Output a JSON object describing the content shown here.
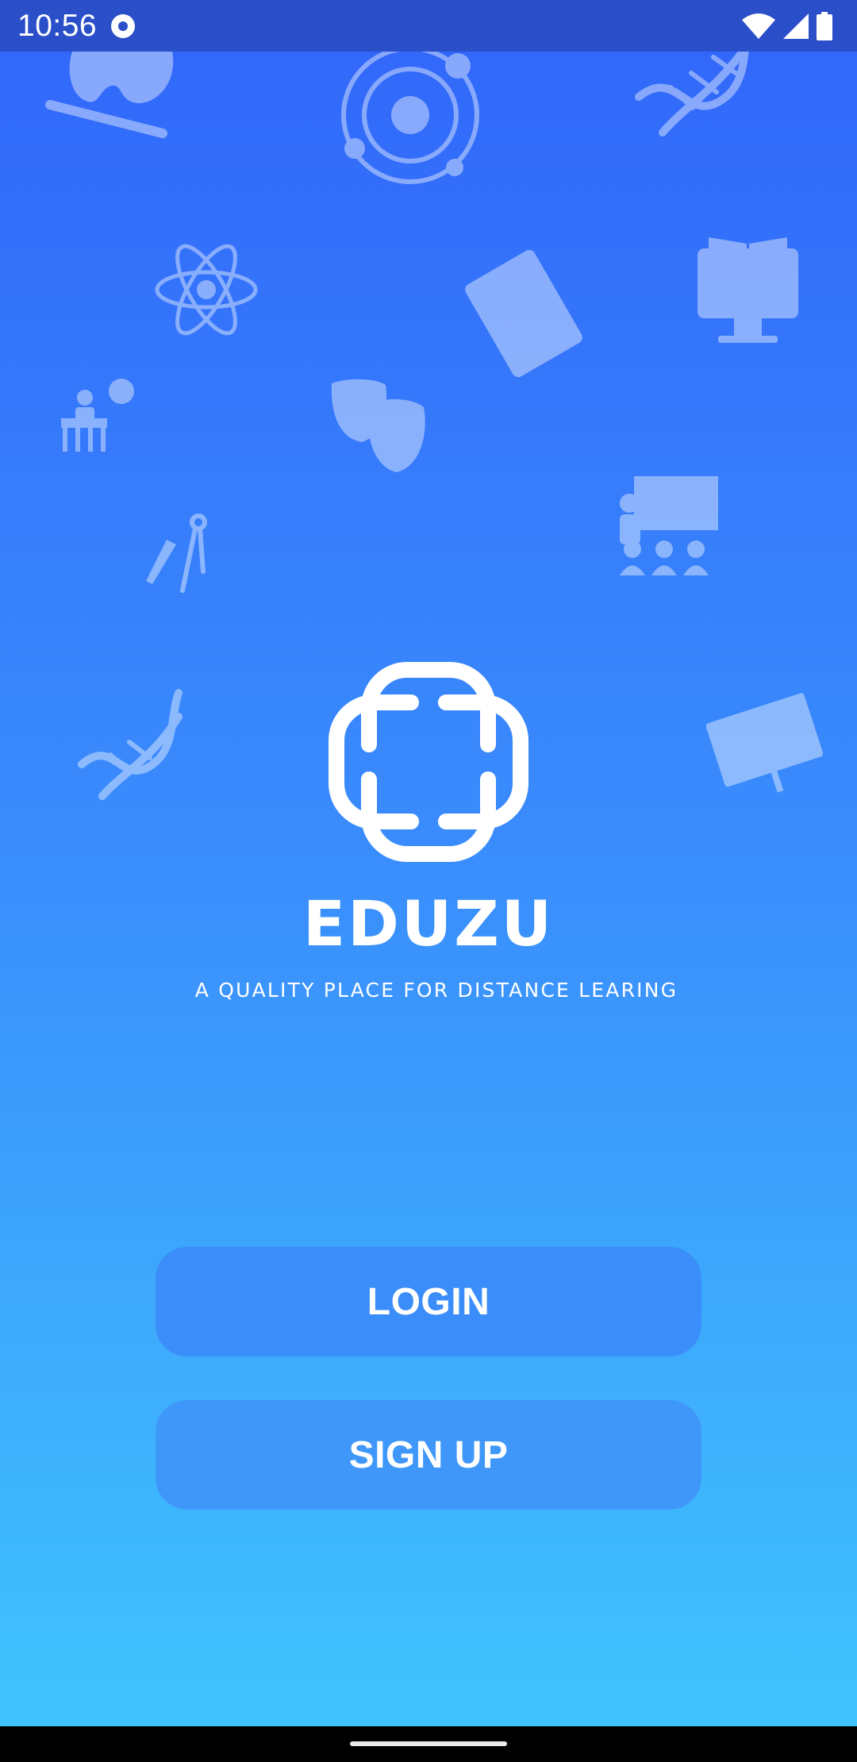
{
  "status_bar": {
    "time": "10:56",
    "icons": [
      "sync-icon",
      "wifi-icon",
      "cell-signal-icon",
      "battery-icon"
    ]
  },
  "background_doodles": [
    "palette-icon",
    "solar-system-icon",
    "dna-icon",
    "atom-icon",
    "tablet-document-icon",
    "monitor-book-icon",
    "student-question-icon",
    "theater-masks-icon",
    "teacher-classroom-icon",
    "compass-pen-icon",
    "graduation-presentation-icon"
  ],
  "logo": {
    "icon": "eduzu-logo-icon"
  },
  "brand": {
    "name": "EDUZU",
    "tagline": "A QUALITY PLACE FOR DISTANCE LEARING"
  },
  "actions": {
    "login_label": "LOGIN",
    "signup_label": "SIGN UP"
  },
  "colors": {
    "gradient_top": "#3166fa",
    "gradient_mid": "#3a8efc",
    "gradient_bottom": "#40c6fd",
    "status_bar": "#2a4fc9",
    "button": "#3b8ef9",
    "text": "#ffffff"
  }
}
